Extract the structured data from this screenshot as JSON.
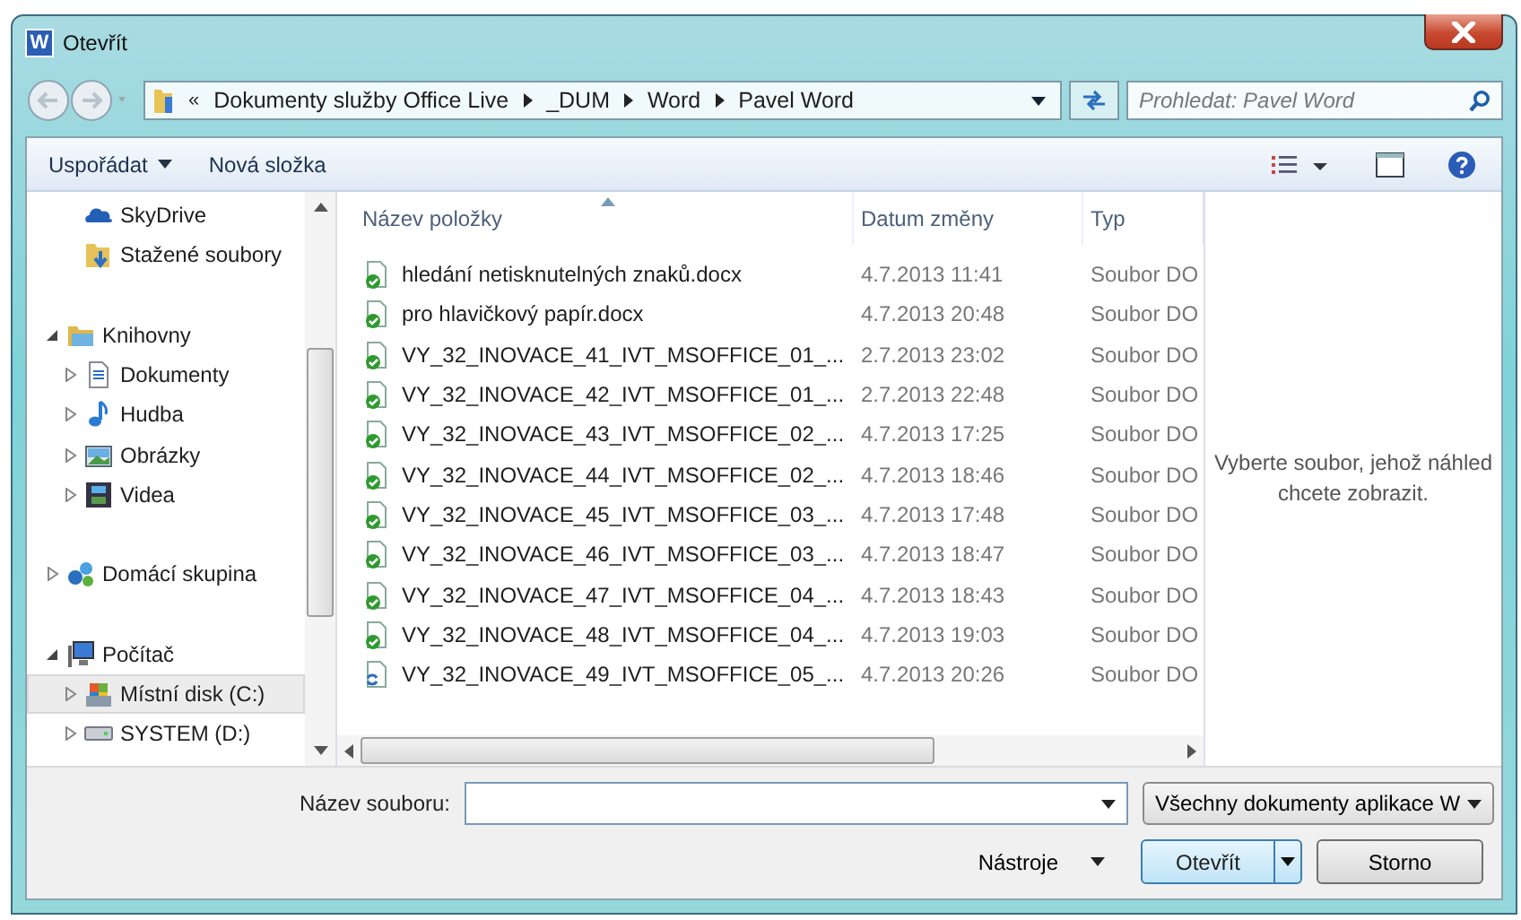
{
  "window": {
    "title": "Otevřít",
    "app_icon_letter": "W"
  },
  "address": {
    "overflow": "«",
    "crumbs": [
      "Dokumenty služby Office Live",
      "_DUM",
      "Word",
      "Pavel Word"
    ]
  },
  "search": {
    "placeholder": "Prohledat: Pavel Word"
  },
  "toolbar": {
    "organize": "Uspořádat",
    "new_folder": "Nová složka"
  },
  "nav": {
    "groups": [
      {
        "items": [
          {
            "label": "SkyDrive",
            "kind": "cloud",
            "selected": false
          },
          {
            "label": "Stažené soubory",
            "kind": "downloads",
            "selected": false
          }
        ]
      },
      {
        "items": [
          {
            "label": "Knihovny",
            "kind": "library",
            "expanded": true,
            "selected": false,
            "children": [
              {
                "label": "Dokumenty",
                "kind": "documents",
                "expanded": false,
                "selected": false
              },
              {
                "label": "Hudba",
                "kind": "music",
                "expanded": false,
                "selected": false
              },
              {
                "label": "Obrázky",
                "kind": "pictures",
                "expanded": false,
                "selected": false
              },
              {
                "label": "Videa",
                "kind": "videos",
                "expanded": false,
                "selected": false
              }
            ]
          }
        ]
      },
      {
        "items": [
          {
            "label": "Domácí skupina",
            "kind": "homegroup",
            "expanded": false,
            "selected": false
          }
        ]
      },
      {
        "items": [
          {
            "label": "Počítač",
            "kind": "computer",
            "expanded": true,
            "selected": false,
            "children": [
              {
                "label": "Místní disk (C:)",
                "kind": "system-drive",
                "expanded": false,
                "selected": true
              },
              {
                "label": "SYSTEM (D:)",
                "kind": "drive",
                "expanded": false,
                "selected": false
              }
            ]
          }
        ]
      }
    ]
  },
  "table": {
    "columns": [
      {
        "label": "Název položky",
        "sorted": true
      },
      {
        "label": "Datum změny",
        "sorted": false
      },
      {
        "label": "Typ",
        "sorted": false
      }
    ],
    "rows": [
      {
        "name": "hledání netisknutelných znaků.docx",
        "date": "4.7.2013 11:41",
        "type": "Soubor DO",
        "kind": "synced"
      },
      {
        "name": "pro hlavičkový papír.docx",
        "date": "4.7.2013 20:48",
        "type": "Soubor DO",
        "kind": "synced"
      },
      {
        "name": "VY_32_INOVACE_41_IVT_MSOFFICE_01_...",
        "date": "2.7.2013 23:02",
        "type": "Soubor DO",
        "kind": "synced"
      },
      {
        "name": "VY_32_INOVACE_42_IVT_MSOFFICE_01_...",
        "date": "2.7.2013 22:48",
        "type": "Soubor DO",
        "kind": "synced"
      },
      {
        "name": "VY_32_INOVACE_43_IVT_MSOFFICE_02_...",
        "date": "4.7.2013 17:25",
        "type": "Soubor DO",
        "kind": "synced"
      },
      {
        "name": "VY_32_INOVACE_44_IVT_MSOFFICE_02_...",
        "date": "4.7.2013 18:46",
        "type": "Soubor DO",
        "kind": "synced"
      },
      {
        "name": "VY_32_INOVACE_45_IVT_MSOFFICE_03_...",
        "date": "4.7.2013 17:48",
        "type": "Soubor DO",
        "kind": "synced"
      },
      {
        "name": "VY_32_INOVACE_46_IVT_MSOFFICE_03_...",
        "date": "4.7.2013 18:47",
        "type": "Soubor DO",
        "kind": "synced"
      },
      {
        "name": "VY_32_INOVACE_47_IVT_MSOFFICE_04_...",
        "date": "4.7.2013 18:43",
        "type": "Soubor DO",
        "kind": "synced"
      },
      {
        "name": "VY_32_INOVACE_48_IVT_MSOFFICE_04_...",
        "date": "4.7.2013 19:03",
        "type": "Soubor DO",
        "kind": "synced"
      },
      {
        "name": "VY_32_INOVACE_49_IVT_MSOFFICE_05_...",
        "date": "4.7.2013 20:26",
        "type": "Soubor DO",
        "kind": "syncing"
      }
    ]
  },
  "preview": {
    "message": "Vyberte soubor, jehož náhled chcete zobrazit."
  },
  "bottom": {
    "filename_label": "Název souboru:",
    "filter": "Všechny dokumenty aplikace W",
    "tools": "Nástroje",
    "open": "Otevřít",
    "cancel": "Storno"
  }
}
